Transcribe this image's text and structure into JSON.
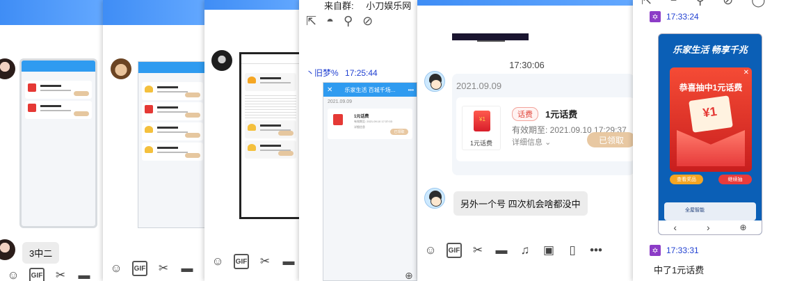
{
  "win1": {
    "messages": [
      "3中二"
    ]
  },
  "win4": {
    "header_text": "来自群:",
    "header_group": "小刀娱乐网",
    "sender": "丶旧梦%",
    "time": "17:25:44",
    "phone": {
      "title": "乐家生活 百城千场...",
      "date": "2021.09.09",
      "item_title": "1元话费",
      "item_detail": "有效期至: 2021.09.10 17:37:03",
      "item_more": "详细信息",
      "claimed": "已领取"
    }
  },
  "win5": {
    "time": "17:30:06",
    "card": {
      "date": "2021.09.09",
      "tag": "话费",
      "title": "1元话费",
      "bag_label": "1元话费",
      "bag_amount": "¥1",
      "expiry": "有效期至: 2021.09.10 17:29:37",
      "details": "详细信息",
      "claimed": "已领取"
    },
    "message": "另外一个号 四次机会啥都没中"
  },
  "win6": {
    "entry1_time": "17:33:24",
    "promo": {
      "header": "乐家生活 畅享千兆",
      "banner": "恭喜抽中1元话费",
      "amount": "¥1",
      "btn_left": "查看奖品",
      "btn_right": "继续抽",
      "label": "全屋智能"
    },
    "nav_prev": "‹",
    "nav_next": "›",
    "entry2_time": "17:33:31",
    "message": "中了1元话费"
  },
  "colors": {
    "accent": "#2f9bf0",
    "claimed": "#e8c8a2",
    "tag_red": "#e2483d"
  }
}
